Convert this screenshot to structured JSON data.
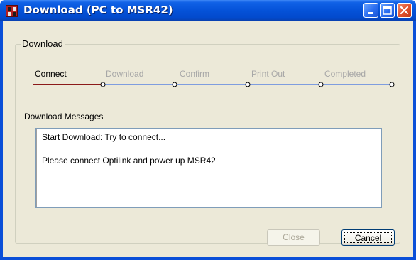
{
  "window": {
    "title": "Download (PC to MSR42)",
    "title_icon": "app-flag-icon",
    "controls": [
      "minimize-icon",
      "maximize-icon",
      "close-icon"
    ]
  },
  "group": {
    "label": "Download"
  },
  "steps": [
    {
      "label": "Connect",
      "active": true
    },
    {
      "label": "Download",
      "active": false
    },
    {
      "label": "Confirm",
      "active": false
    },
    {
      "label": "Print Out",
      "active": false
    },
    {
      "label": "Completed",
      "active": false
    }
  ],
  "progress": {
    "current_step": 1,
    "total_steps": 5
  },
  "messages": {
    "label": "Download Messages",
    "lines": [
      "Start Download: Try to connect...",
      "Please connect Optilink and power up MSR42"
    ]
  },
  "buttons": {
    "close_label": "Close",
    "cancel_label": "Cancel"
  },
  "colors": {
    "titlebar": "#0552d8",
    "progress_done": "#8b1a1a",
    "progress_pending": "#7f9ddf",
    "dialog_bg": "#ece9d8"
  }
}
